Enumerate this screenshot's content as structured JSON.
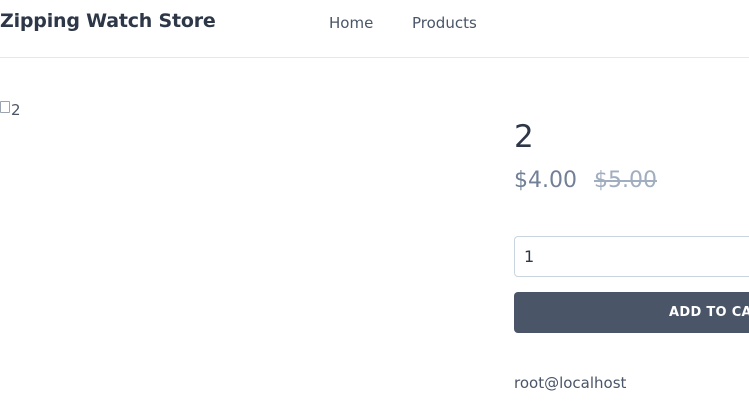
{
  "header": {
    "brand": "Zipping Watch Store",
    "nav": {
      "home": "Home",
      "products": "Products"
    }
  },
  "product": {
    "image_alt": "2",
    "title": "2",
    "price_sale": "$4.00",
    "price_original": "$5.00",
    "quantity_value": "1",
    "add_to_cart_label": "ADD TO CART",
    "contact": "root@localhost"
  },
  "colors": {
    "button_bg": "#4a5568",
    "text": "#4a5568",
    "heading": "#2d3748",
    "strikethrough": "#a0aec0"
  },
  "icons": {
    "broken_image": "broken-image-icon"
  }
}
